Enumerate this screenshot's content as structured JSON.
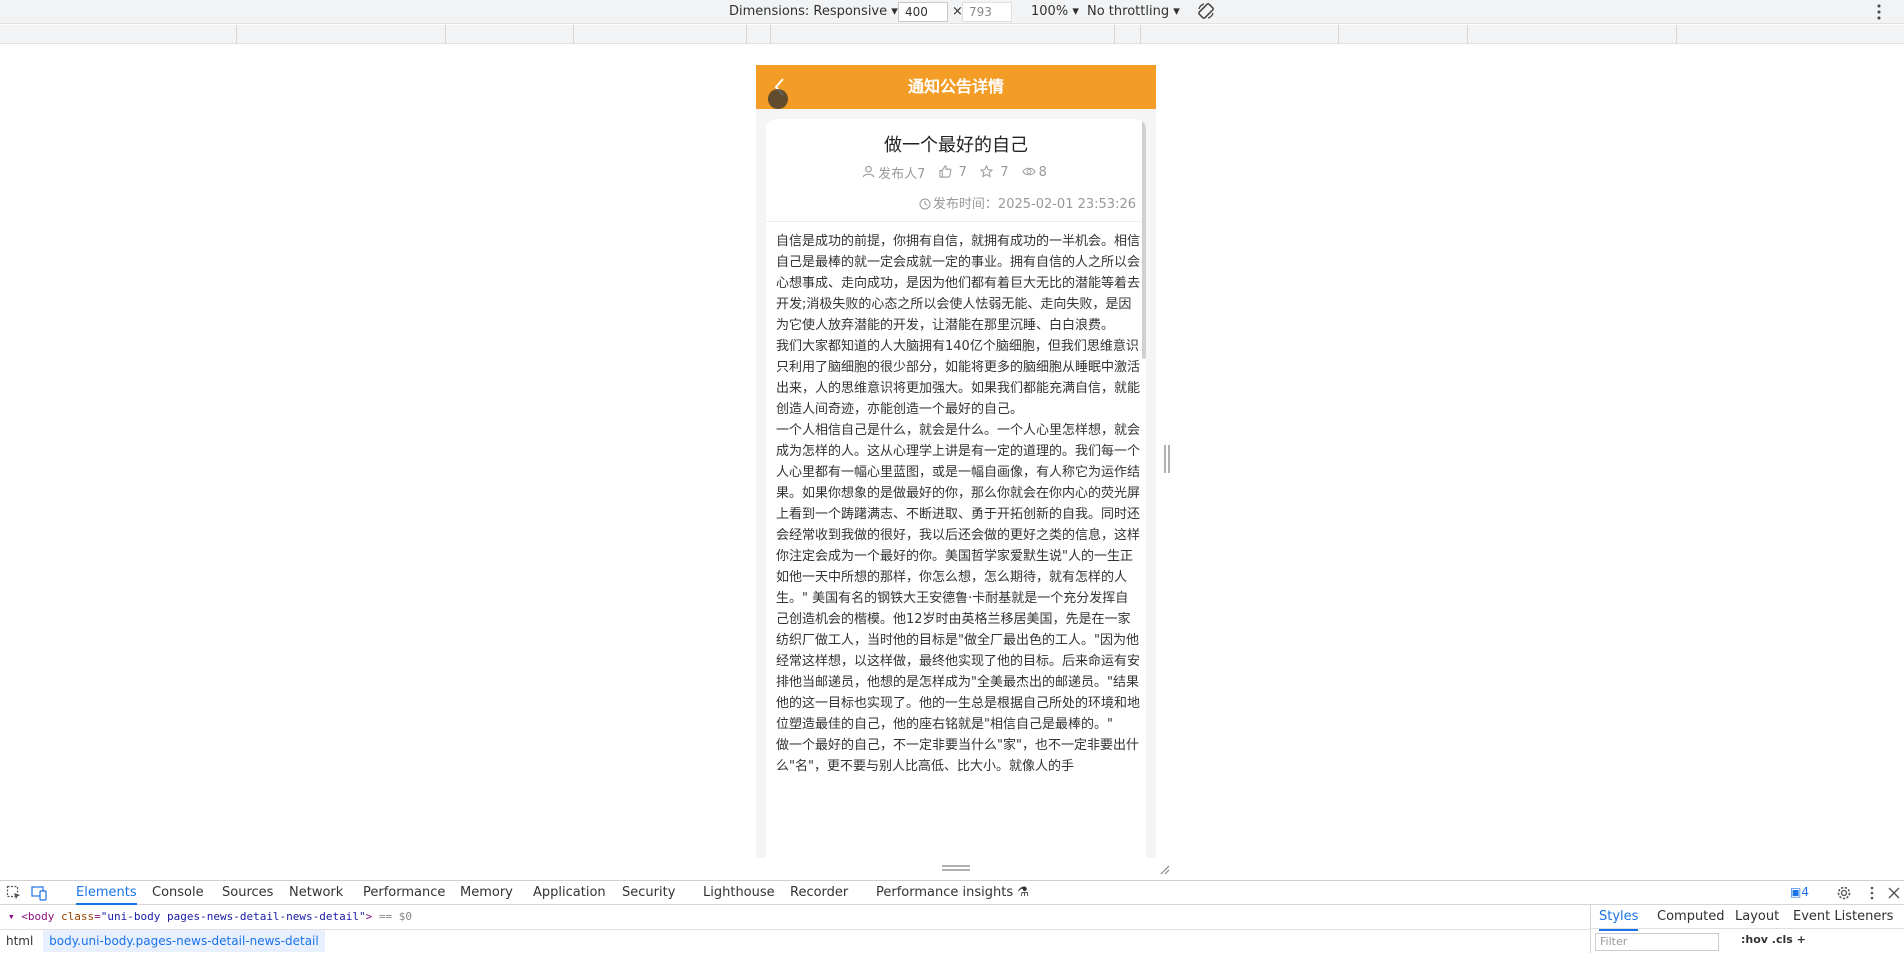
{
  "device_toolbar": {
    "dimensions": "Dimensions: Responsive",
    "width": "400",
    "times": "×",
    "height": "793",
    "zoom": "100%",
    "throttling": "No throttling"
  },
  "app": {
    "nav_title": "通知公告详情",
    "article": {
      "title": "做一个最好的自己",
      "publisher": "发布人7",
      "likes": "7",
      "favorites": "7",
      "views": "8",
      "publish_time": "发布时间：2025-02-01 23:53:26",
      "paragraphs": [
        "自信是成功的前提，你拥有自信，就拥有成功的一半机会。相信自己是最棒的就一定会成就一定的事业。拥有自信的人之所以会心想事成、走向成功，是因为他们都有着巨大无比的潜能等着去开发;消极失败的心态之所以会使人怯弱无能、走向失败，是因为它使人放弃潜能的开发，让潜能在那里沉睡、白白浪费。",
        "我们大家都知道的人大脑拥有140亿个脑细胞，但我们思维意识只利用了脑细胞的很少部分，如能将更多的脑细胞从睡眠中激活出来，人的思维意识将更加强大。如果我们都能充满自信，就能创造人间奇迹，亦能创造一个最好的自己。",
        "一个人相信自己是什么，就会是什么。一个人心里怎样想，就会成为怎样的人。这从心理学上讲是有一定的道理的。我们每一个人心里都有一幅心里蓝图，或是一幅自画像，有人称它为运作结果。如果你想象的是做最好的你，那么你就会在你内心的荧光屏上看到一个踌躇满志、不断进取、勇于开拓创新的自我。同时还会经常收到我做的很好，我以后还会做的更好之类的信息，这样你注定会成为一个最好的你。美国哲学家爱默生说\"人的一生正如他一天中所想的那样，你怎么想，怎么期待，就有怎样的人生。\" 美国有名的钢铁大王安德鲁·卡耐基就是一个充分发挥自己创造机会的楷模。他12岁时由英格兰移居美国，先是在一家纺织厂做工人，当时他的目标是\"做全厂最出色的工人。\"因为他经常这样想，以这样做，最终他实现了他的目标。后来命运有安排他当邮递员，他想的是怎样成为\"全美最杰出的邮递员。\"结果他的这一目标也实现了。他的一生总是根据自己所处的环境和地位塑造最佳的自己，他的座右铭就是\"相信自己是最棒的。\"",
        "做一个最好的自己，不一定非要当什么\"家\"，也不一定非要出什么\"名\"，更不要与别人比高低、比大小。就像人的手"
      ]
    }
  },
  "devtools": {
    "tabs": [
      "Elements",
      "Console",
      "Sources",
      "Network",
      "Performance",
      "Memory",
      "Application",
      "Security",
      "Lighthouse",
      "Recorder",
      "Performance insights"
    ],
    "issues_count": "4",
    "dom_line": {
      "tag_open": "<body",
      "attr": "class",
      "value": "\"uni-body pages-news-detail-news-detail\"",
      "tag_close": ">",
      "eq": "== $0"
    },
    "breadcrumbs": [
      "html",
      "body.uni-body.pages-news-detail-news-detail"
    ],
    "side_tabs": [
      "Styles",
      "Computed",
      "Layout",
      "Event Listeners"
    ],
    "filter_placeholder": "Filter",
    "style_tools": ":hov  .cls  +"
  },
  "colors": {
    "nav": "#f39c26",
    "devtools_accent": "#1a73e8"
  },
  "icons": [
    "chevron-down-icon",
    "rotate-icon",
    "more-vert-icon",
    "back-arrow-icon",
    "user-icon",
    "thumbs-up-icon",
    "star-icon",
    "eye-icon",
    "clock-icon",
    "inspect-icon",
    "device-toggle-icon",
    "issues-icon",
    "gear-icon",
    "close-icon"
  ]
}
